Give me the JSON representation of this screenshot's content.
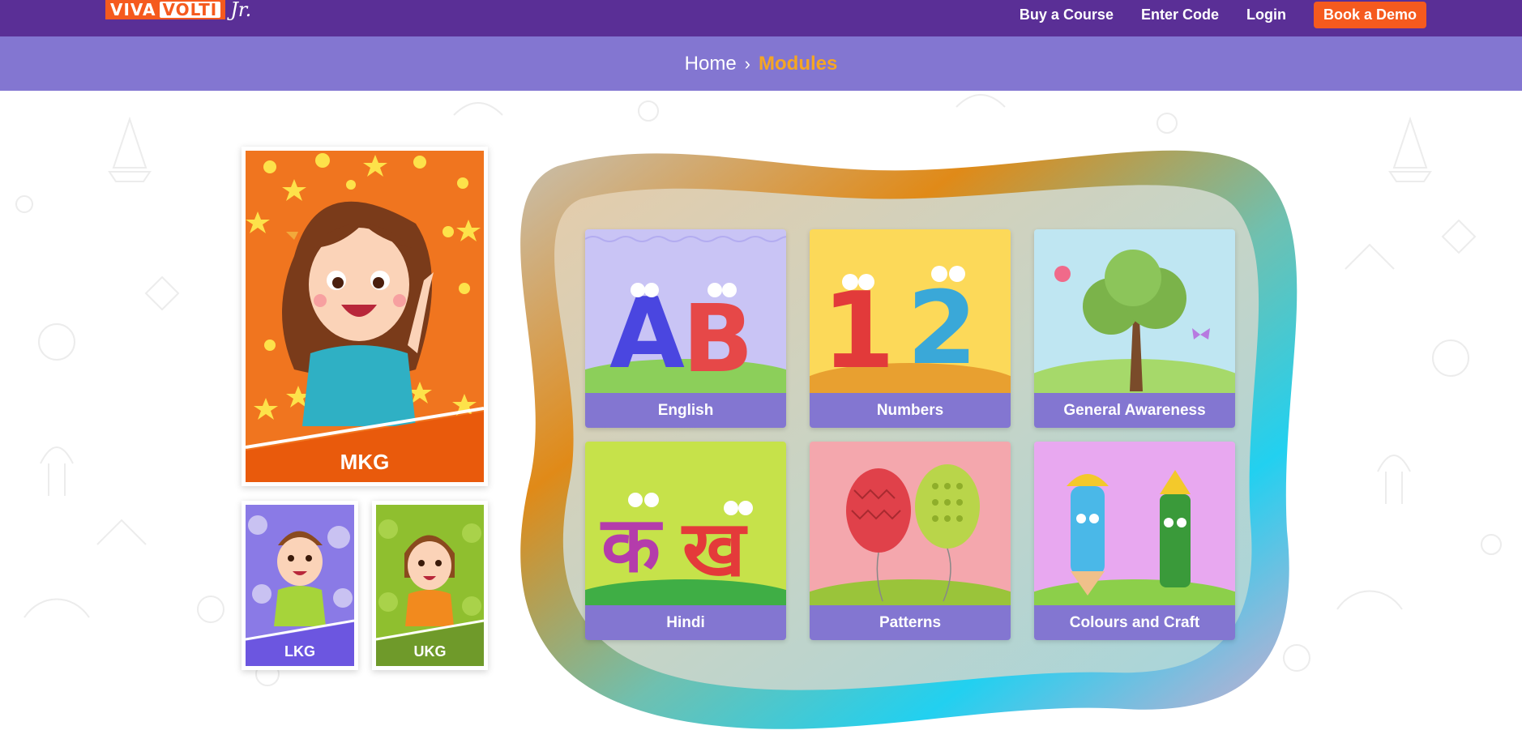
{
  "header": {
    "logo_text_viva": "VIVA",
    "logo_text_volti": "VOLTI",
    "logo_text_jr": "Jr.",
    "nav": [
      {
        "label": "Buy a Course"
      },
      {
        "label": "Enter Code"
      },
      {
        "label": "Login"
      }
    ],
    "demo_button": "Book a Demo"
  },
  "breadcrumb": {
    "home": "Home",
    "separator": "›",
    "current": "Modules"
  },
  "levels": [
    {
      "label": "MKG",
      "color": "#f0751f"
    },
    {
      "label": "LKG",
      "color": "#6c56e0"
    },
    {
      "label": "UKG",
      "color": "#7da430"
    }
  ],
  "modules": [
    {
      "label": "English",
      "bg": "#c9c4f5"
    },
    {
      "label": "Numbers",
      "bg": "#fcd959"
    },
    {
      "label": "General Awareness",
      "bg": "#bfe6f2"
    },
    {
      "label": "Hindi",
      "bg": "#c6e24a"
    },
    {
      "label": "Patterns",
      "bg": "#f4a7ad"
    },
    {
      "label": "Colours and Craft",
      "bg": "#e8a8f0"
    }
  ],
  "art_text": {
    "english_a": "A",
    "english_b": "B",
    "numbers_1": "1",
    "numbers_2": "2",
    "hindi_ka": "क",
    "hindi_kha": "ख"
  },
  "colors": {
    "header_bg": "#5a2f96",
    "band_bg": "#8376d1",
    "accent_orange": "#f55a1e",
    "crumb_active": "#f5a623",
    "module_label_bg": "#8376d1"
  }
}
